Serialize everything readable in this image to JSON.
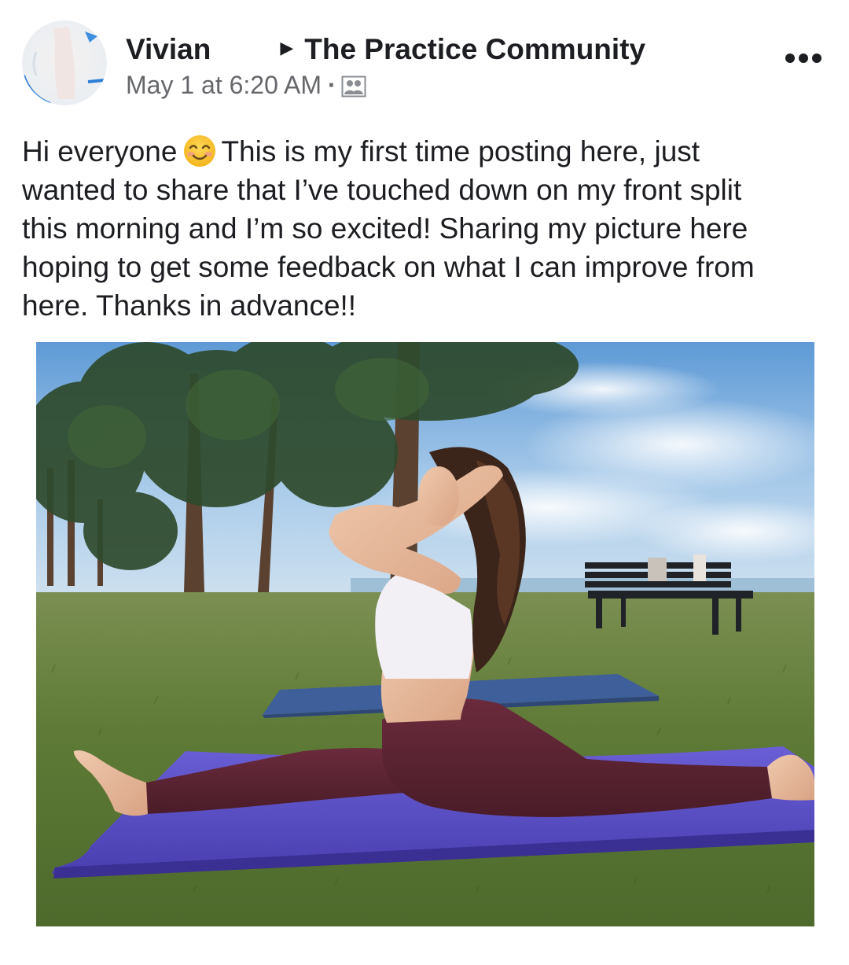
{
  "post": {
    "author": "Vivian",
    "group": "The Practice Community",
    "timestamp": "May 1 at 6:20 AM",
    "meta_separator": "·",
    "audience_icon": "group-members-icon",
    "more_icon": "more-options-icon",
    "text_lines": [
      {
        "before_emoji": "Hi everyone",
        "after_emoji": "This is my first time posting here, just"
      },
      {
        "text": "wanted to share that I’ve touched down on my front split"
      },
      {
        "text": "this morning and I’m so excited! Sharing my picture here"
      },
      {
        "text": "hoping to get some feedback on what I can improve from"
      },
      {
        "text": "here. Thanks in advance!!"
      }
    ],
    "emoji": "smiling-face-with-smiling-eyes",
    "photo": {
      "subject": "woman doing front split on purple yoga mat in park",
      "colors": {
        "sky": "#8fbbe3",
        "grass": "#5e7c38",
        "mat_front": "#5b4fc4",
        "mat_back": "#3e5f9a",
        "leggings": "#5a2332",
        "top": "#f2f0f4"
      }
    }
  },
  "colors": {
    "text": "#1c1e21",
    "secondary": "#65676b",
    "background": "#ffffff"
  }
}
